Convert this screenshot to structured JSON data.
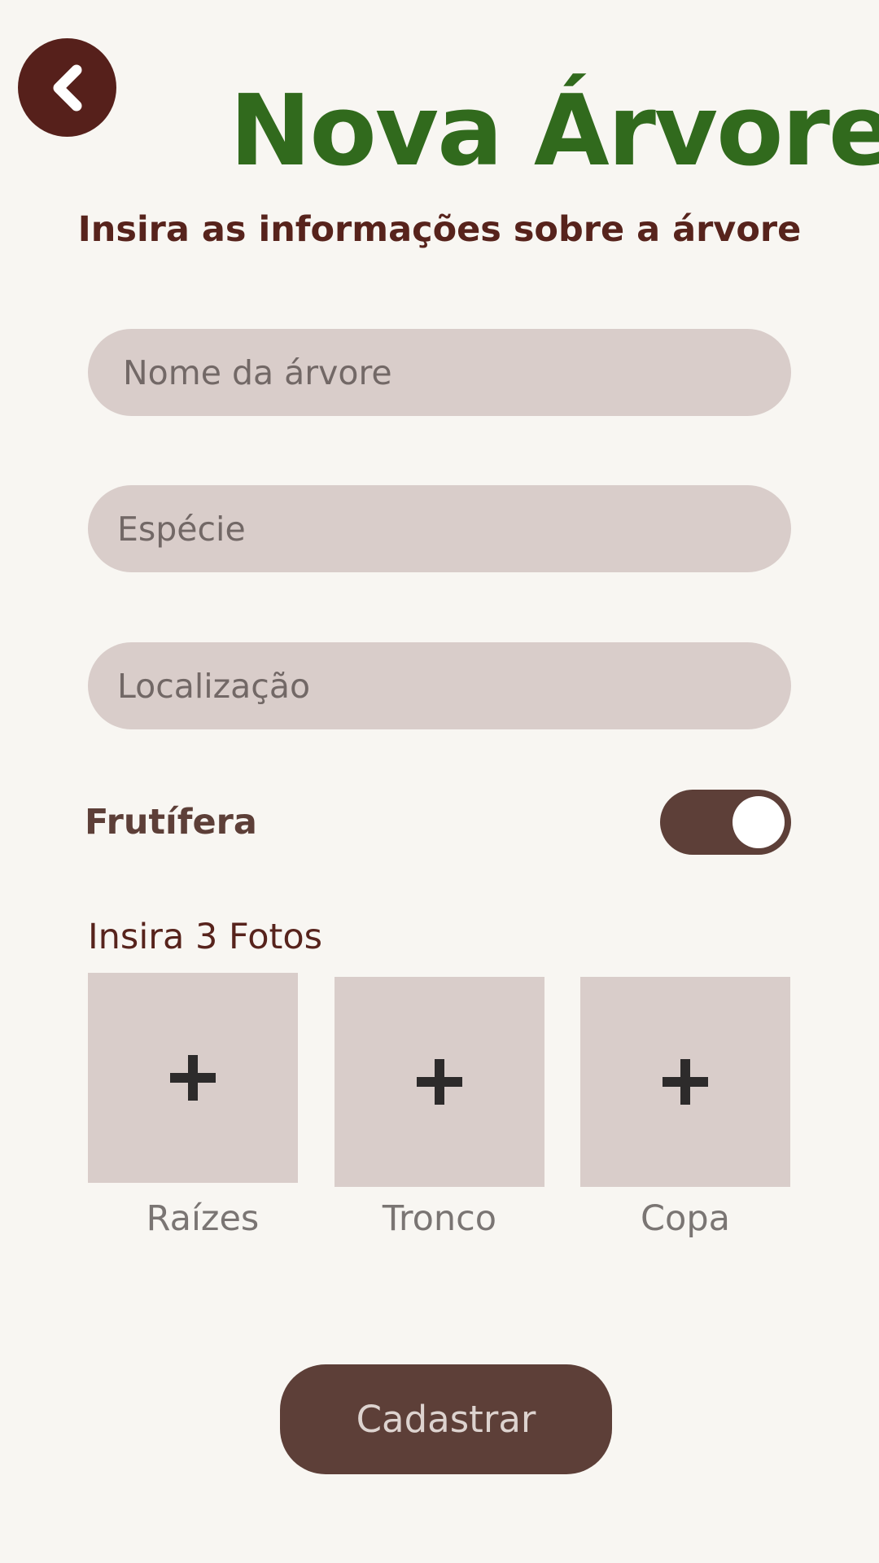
{
  "header": {
    "back_icon": "chevron-left-icon",
    "title": "Nova Árvore",
    "subtitle": "Insira as informações sobre a árvore"
  },
  "form": {
    "nome_placeholder": "Nome da árvore",
    "especie_placeholder": "Espécie",
    "localizacao_placeholder": "Localização",
    "frutifera_label": "Frutífera",
    "frutifera_on": true
  },
  "photos": {
    "label": "Insira 3 Fotos",
    "add_icon": "plus-icon",
    "items": [
      {
        "caption": "Raízes"
      },
      {
        "caption": "Tronco"
      },
      {
        "caption": "Copa"
      }
    ]
  },
  "submit": {
    "label": "Cadastrar"
  },
  "colors": {
    "background": "#f8f6f2",
    "title_green": "#316a1d",
    "dark_brown": "#56201b",
    "brown": "#5d3f38",
    "field_bg": "#d9cdca"
  }
}
